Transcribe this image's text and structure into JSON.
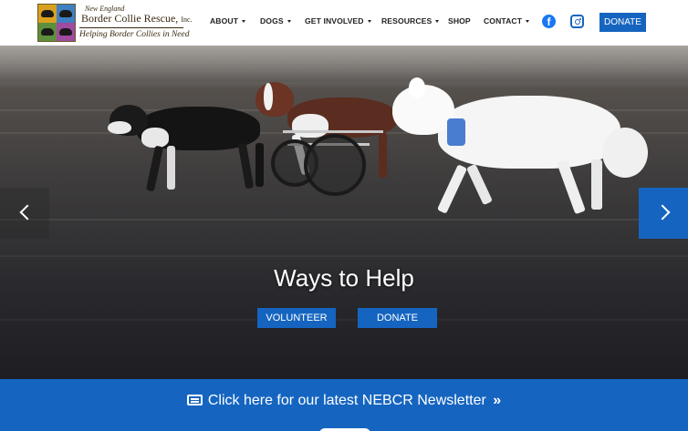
{
  "logo": {
    "line1": "New England",
    "line2": "Border Collie Rescue,",
    "line2_suffix": "Inc.",
    "line3": "Helping Border Collies in Need"
  },
  "nav": {
    "items": [
      {
        "label": "ABOUT",
        "dropdown": true
      },
      {
        "label": "DOGS",
        "dropdown": true
      },
      {
        "label": "GET INVOLVED",
        "dropdown": true
      },
      {
        "label": "RESOURCES",
        "dropdown": true
      },
      {
        "label": "SHOP",
        "dropdown": false
      },
      {
        "label": "CONTACT",
        "dropdown": true
      }
    ],
    "social": [
      "facebook-icon",
      "instagram-icon"
    ],
    "donate_label": "DONATE"
  },
  "hero": {
    "title": "Ways to Help",
    "volunteer_label": "VOLUNTEER",
    "donate_label": "DONATE"
  },
  "newsletter": {
    "text": "Click here for our latest NEBCR Newsletter"
  },
  "colors": {
    "accent": "#1565c0",
    "text": "#222222"
  }
}
